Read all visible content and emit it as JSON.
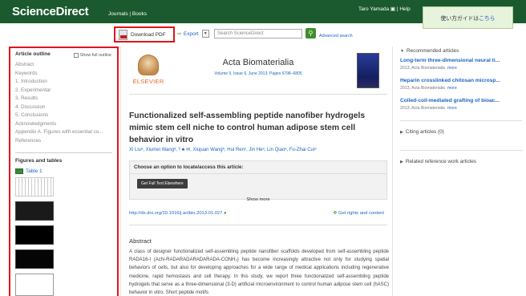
{
  "header": {
    "logo": "ScienceDirect",
    "nav_journals": "Journals",
    "nav_sep": " | ",
    "nav_books": "Books",
    "user_name": "Taro Yamada",
    "user_icon": "▣",
    "help": "Help"
  },
  "guide": {
    "prefix": "使い方ガイドは",
    "link": "こちら"
  },
  "toolbar": {
    "download_pdf": "Download PDF",
    "export": "Export",
    "search_placeholder": "Search ScienceDirect",
    "advanced_search": "Advanced search"
  },
  "outline": {
    "title": "Article outline",
    "show_full": "Show full outline",
    "items": [
      "Abstract",
      "Keywords",
      "1. Introduction",
      "2. Experimental",
      "3. Results",
      "4. Discussion",
      "5. Conclusions",
      "Acknowledgments",
      "Appendix A. Figures with essential co...",
      "References"
    ],
    "figures_title": "Figures and tables",
    "table_link": "Table 1"
  },
  "article": {
    "journal": "Acta Biomaterialia",
    "volume": "Volume 9, Issue 6, June 2013, Pages 6798–6805",
    "publisher": "ELSEVIER",
    "title": "Functionalized self-assembling peptide nanofiber hydrogels mimic stem cell niche to control human adipose stem cell behavior in vitro",
    "authors": "Xi Liuᵃ, Xiumei Wangᵃ, ᵇ ♣ ✉, Xiujuan Wangᵇ, Hui Renᶜ, Jin Heᵃ, Lin Qiaoᵃ, Fu-Zhai Cuiᵃ",
    "choose_text": "Choose an option to locate/access this article:",
    "fulltext_button": "Get Full Text Elsewhere",
    "show_more": "Show more",
    "doi": "http://dx.doi.org/10.1016/j.actbio.2013.01.027",
    "rights": "Get rights and content",
    "abstract_heading": "Abstract",
    "abstract": "A class of designer functionalized self-assembling peptide nanofiber scaffolds developed from self-assembling peptide RADA16-I (AcN-RADARADARADARADA-CONH₂) has become increasingly attractive not only for studying spatial behaviors of cells, but also for developing approaches for a wide range of medical applications including regenerative medicine, rapid hemostasis and cell therapy. In this study, we report three functionalized self-assembling peptide hydrogels that serve as a three-dimensional (3-D) artificial microenvironment to control human adipose stem cell (hASC) behavior in vitro. Short peptide motifs"
  },
  "recommended": {
    "heading": "Recommended articles",
    "items": [
      {
        "title": "Long-term three-dimensional neural ti...",
        "meta": "2013, Acta Biomaterialia",
        "more": "more"
      },
      {
        "title": "Heparin crosslinked chitosan microsp...",
        "meta": "2013, Acta Biomaterialia",
        "more": "more"
      },
      {
        "title": "Coiled-coil-mediated grafting of bioac...",
        "meta": "2013, Acta Biomaterialia",
        "more": "more"
      }
    ],
    "citing": "Citing articles (0)",
    "related": "Related reference work articles"
  }
}
